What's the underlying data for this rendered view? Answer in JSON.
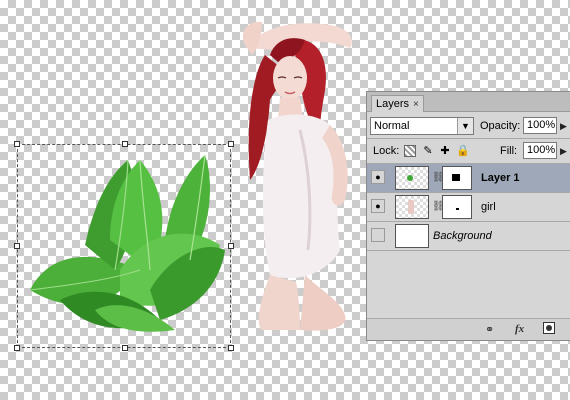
{
  "panel": {
    "tab_label": "Layers",
    "tab_close": "×",
    "blend_mode": "Normal",
    "opacity_label": "Opacity:",
    "opacity_value": "100%",
    "lock_label": "Lock:",
    "fill_label": "Fill:",
    "fill_value": "100%"
  },
  "layers": [
    {
      "name": "Layer 1",
      "visible": true,
      "selected": true,
      "has_mask": true,
      "italic": false
    },
    {
      "name": "girl",
      "visible": true,
      "selected": false,
      "has_mask": true,
      "italic": false
    },
    {
      "name": "Background",
      "visible": false,
      "selected": false,
      "has_mask": false,
      "italic": true
    }
  ],
  "bottom_bar": {
    "link_icon": "link-layers-icon",
    "fx_label": "fx",
    "mask_icon": "add-mask-icon"
  },
  "colors": {
    "selected_row": "#9fa8b8",
    "panel_bg": "#d6d6d6",
    "leaf_green": "#3fa834",
    "hair_red": "#b3202a"
  }
}
